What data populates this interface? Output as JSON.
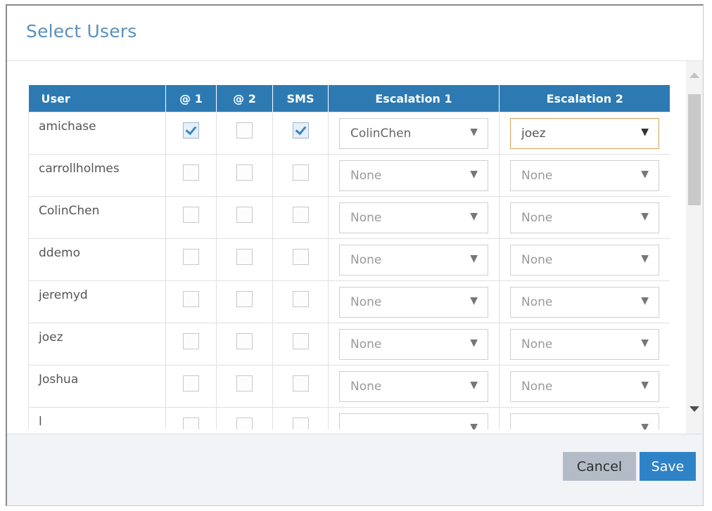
{
  "dialog": {
    "title": "Select Users"
  },
  "table": {
    "headers": {
      "user": "User",
      "at1": "@ 1",
      "at2": "@ 2",
      "sms": "SMS",
      "escalation1": "Escalation 1",
      "escalation2": "Escalation 2"
    },
    "rows": [
      {
        "user": "amichase",
        "at1": true,
        "at2": false,
        "sms": true,
        "escalation1": "ColinChen",
        "escalation2": "joez"
      },
      {
        "user": "carrollholmes",
        "at1": false,
        "at2": false,
        "sms": false,
        "escalation1": "None",
        "escalation2": "None"
      },
      {
        "user": "ColinChen",
        "at1": false,
        "at2": false,
        "sms": false,
        "escalation1": "None",
        "escalation2": "None"
      },
      {
        "user": "ddemo",
        "at1": false,
        "at2": false,
        "sms": false,
        "escalation1": "None",
        "escalation2": "None"
      },
      {
        "user": "jeremyd",
        "at1": false,
        "at2": false,
        "sms": false,
        "escalation1": "None",
        "escalation2": "None"
      },
      {
        "user": "joez",
        "at1": false,
        "at2": false,
        "sms": false,
        "escalation1": "None",
        "escalation2": "None"
      },
      {
        "user": "Joshua",
        "at1": false,
        "at2": false,
        "sms": false,
        "escalation1": "None",
        "escalation2": "None"
      },
      {
        "user": "l",
        "at1": false,
        "at2": false,
        "sms": false,
        "escalation1": "",
        "escalation2": ""
      }
    ],
    "focused_select": "escalation2-row-0"
  },
  "icons": {
    "dropdown_arrow": "▼",
    "scroll_up": "triangle-up-icon",
    "scroll_down": "triangle-down-icon",
    "checkmark": "check-icon"
  },
  "footer": {
    "cancel_label": "Cancel",
    "save_label": "Save"
  },
  "colors": {
    "header_bg": "#2d7ab3",
    "title": "#5b8fbd",
    "save_bg": "#2e83c7",
    "cancel_bg": "#b3bcc6",
    "focus_border": "#d9a15a"
  }
}
